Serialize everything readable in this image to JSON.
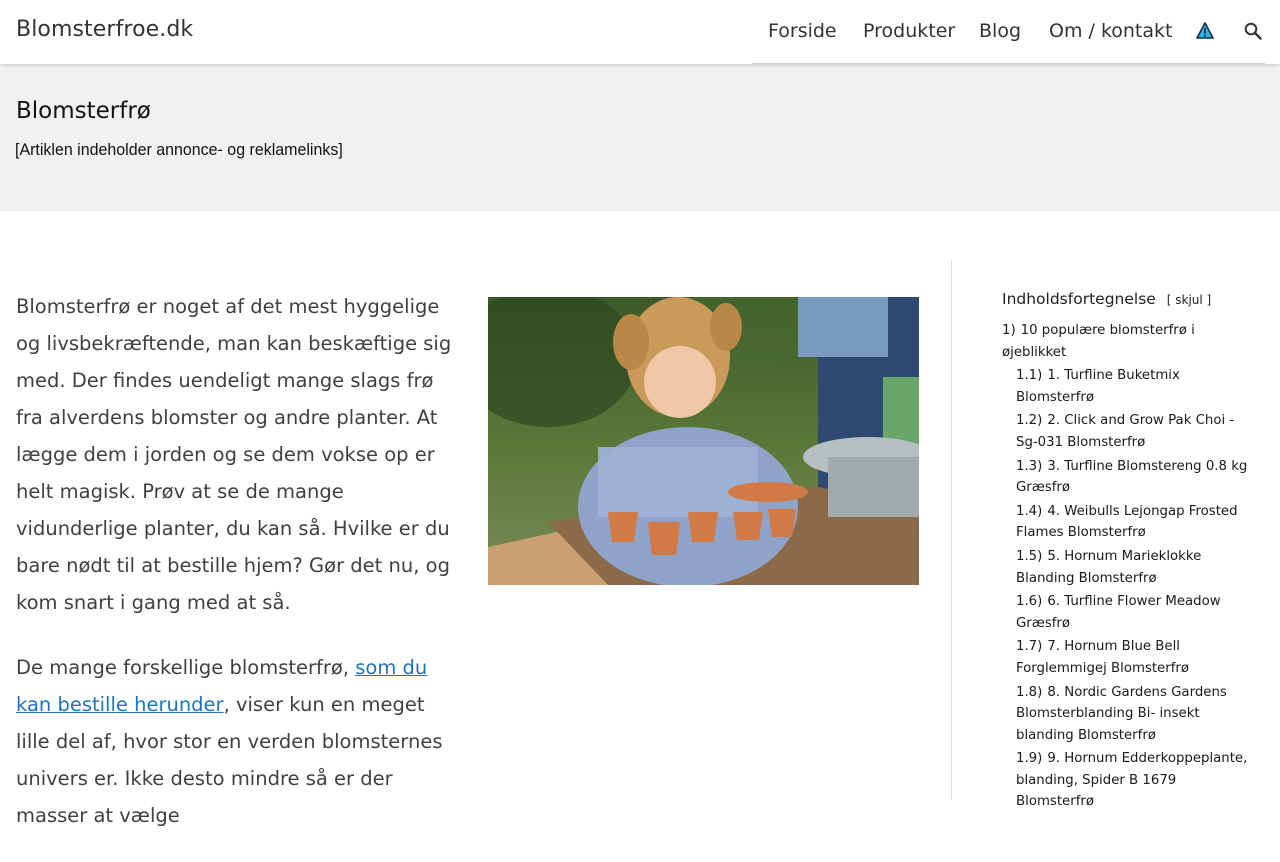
{
  "header": {
    "site_title": "Blomsterfroe.dk",
    "nav": [
      "Forside",
      "Produkter",
      "Blog",
      "Om / kontakt"
    ],
    "icons": [
      "warning-icon",
      "search-icon"
    ]
  },
  "hero": {
    "title": "Blomsterfrø",
    "disclaimer": "[Artiklen indeholder annonce- og reklamelinks]"
  },
  "content": {
    "p1": "Blomsterfrø er noget af det mest hyggelige og livsbekræftende, man kan beskæftige sig med. Der findes uendeligt mange slags frø fra alverdens blomster og andre planter. At lægge dem i jorden og se dem vokse op er helt magisk. Prøv at se de mange vidunderlige planter, du kan så. Hvilke er du bare nødt til at bestille hjem? Gør det nu, og kom snart i gang med at så.",
    "p2_before": "De mange forskellige blomsterfrø, ",
    "p2_link": "som du kan bestille herunder",
    "p2_after": ", viser kun en meget lille del af, hvor stor en verden blomsternes univers er. Ikke desto mindre så er der masser at vælge"
  },
  "toc": {
    "title": "Indholdsfortegnelse",
    "toggle": "skjul",
    "items": [
      {
        "num": "1)",
        "label": "10 populære blomsterfrø i øjeblikket"
      },
      {
        "num": "1.1)",
        "label": "1. Turfline Buketmix Blomsterfrø"
      },
      {
        "num": "1.2)",
        "label": "2. Click and Grow Pak Choi - Sg-031 Blomsterfrø"
      },
      {
        "num": "1.3)",
        "label": "3. Turfline Blomstereng 0.8 kg Græsfrø"
      },
      {
        "num": "1.4)",
        "label": "4. Weibulls Lejongap Frosted Flames Blomsterfrø"
      },
      {
        "num": "1.5)",
        "label": "5. Hornum Marieklokke Blanding Blomsterfrø"
      },
      {
        "num": "1.6)",
        "label": "6. Turfline Flower Meadow Græsfrø"
      },
      {
        "num": "1.7)",
        "label": "7. Hornum Blue Bell Forglemmigej Blomsterfrø"
      },
      {
        "num": "1.8)",
        "label": "8. Nordic Gardens Gardens Blomsterblanding Bi- insekt blanding Blomsterfrø"
      },
      {
        "num": "1.9)",
        "label": "9. Hornum Edderkoppeplante, blanding, Spider B 1679 Blomsterfrø"
      }
    ]
  },
  "colors": {
    "link": "#1e73be",
    "hero_bg": "#f1f1f1",
    "text": "#404040",
    "warning": "#2bb6e0"
  }
}
